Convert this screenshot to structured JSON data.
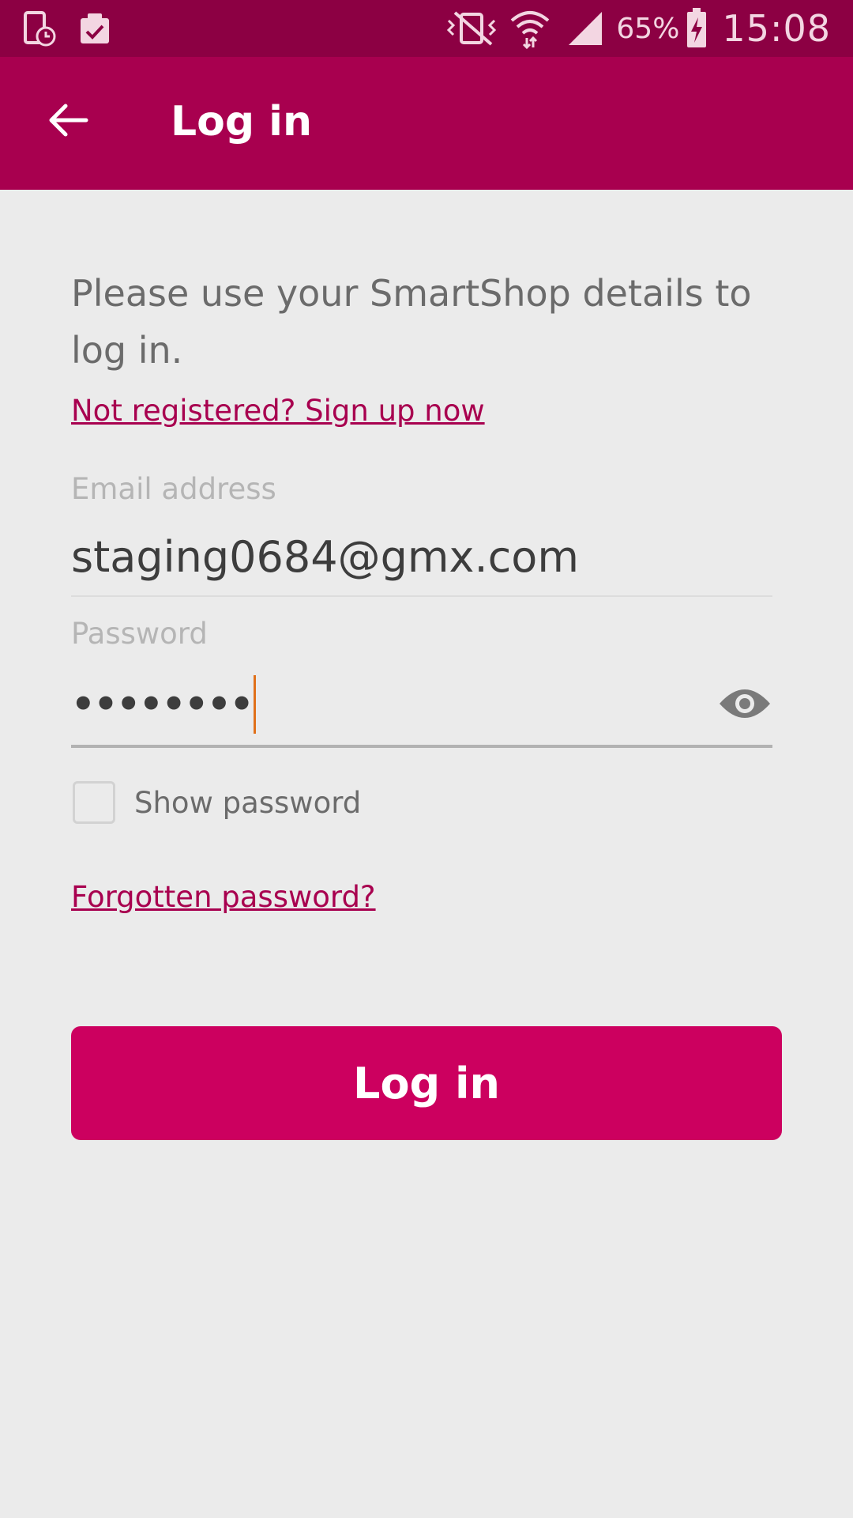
{
  "status_bar": {
    "battery_percent": "65%",
    "time": "15:08",
    "left_icons": [
      "device-clock-icon",
      "clipboard-check-icon"
    ],
    "right_icons": [
      "vibrate-off-icon",
      "wifi-icon",
      "signal-icon",
      "battery-charging-icon"
    ]
  },
  "app_bar": {
    "title": "Log in",
    "back_icon": "back-arrow-icon"
  },
  "form": {
    "intro_text": "Please use your SmartShop details to log in.",
    "signup_link": "Not registered? Sign up now",
    "email_label": "Email address",
    "email_value": "staging0684@gmx.com",
    "password_label": "Password",
    "password_masked": "••••••••",
    "password_visibility_icon": "eye-icon",
    "show_password_label": "Show password",
    "show_password_checked": false,
    "forgot_link": "Forgotten password?",
    "login_button": "Log in"
  },
  "colors": {
    "status_bar": "#8c0043",
    "app_bar": "#a8004f",
    "accent": "#cc005f",
    "link": "#a8004f",
    "caret": "#e0701a",
    "background": "#ebebeb"
  }
}
